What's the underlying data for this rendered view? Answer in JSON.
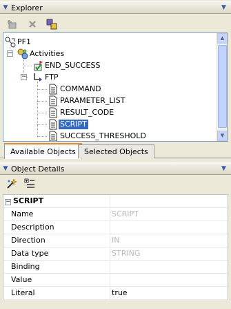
{
  "explorer": {
    "title": "Explorer",
    "toolbar": [
      "add-node-icon",
      "delete-icon",
      "properties-icon"
    ],
    "tree": [
      {
        "label": "PF1",
        "icon": "process-flow-icon",
        "level": 0
      },
      {
        "label": "Activities",
        "icon": "activities-icon",
        "level": 1,
        "expanded": true
      },
      {
        "label": "END_SUCCESS",
        "icon": "end-success-icon",
        "level": 2
      },
      {
        "label": "FTP",
        "icon": "ftp-activity-icon",
        "level": 2,
        "expanded": true
      },
      {
        "label": "COMMAND",
        "icon": "parameter-icon",
        "level": 3
      },
      {
        "label": "PARAMETER_LIST",
        "icon": "parameter-icon",
        "level": 3
      },
      {
        "label": "RESULT_CODE",
        "icon": "parameter-icon",
        "level": 3
      },
      {
        "label": "SCRIPT",
        "icon": "parameter-icon",
        "level": 3,
        "selected": true
      },
      {
        "label": "SUCCESS_THRESHOLD",
        "icon": "parameter-icon",
        "level": 3
      }
    ],
    "tabs": [
      {
        "label": "Available Objects",
        "active": true
      },
      {
        "label": "Selected Objects",
        "active": false
      }
    ]
  },
  "details": {
    "title": "Object Details",
    "toolbar": [
      "wand-icon",
      "categorize-icon"
    ],
    "category": "SCRIPT",
    "properties": [
      {
        "name": "Name",
        "value": "SCRIPT",
        "disabled": true
      },
      {
        "name": "Description",
        "value": "",
        "disabled": false
      },
      {
        "name": "Direction",
        "value": "IN",
        "disabled": true
      },
      {
        "name": "Data type",
        "value": "STRING",
        "disabled": true
      },
      {
        "name": "Binding",
        "value": "",
        "disabled": false
      },
      {
        "name": "Value",
        "value": "",
        "disabled": false
      },
      {
        "name": "Literal",
        "value": "true",
        "disabled": false
      }
    ]
  },
  "colors": {
    "selection": "#316ac5",
    "accent": "#3a5ea8",
    "tab_highlight": "#e68b2c"
  }
}
